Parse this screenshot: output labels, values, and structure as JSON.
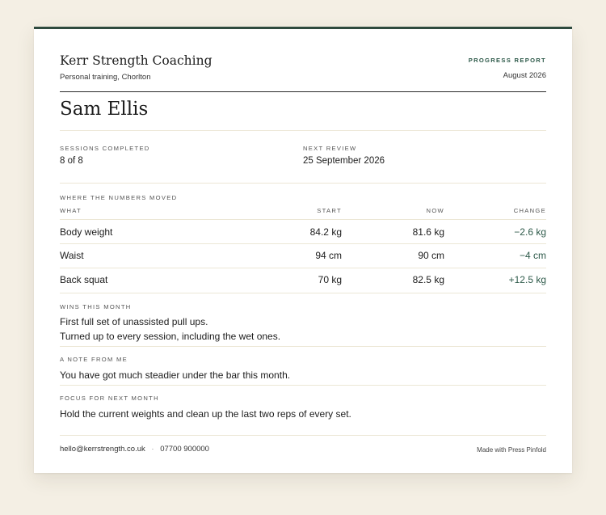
{
  "business": {
    "name": "Kerr Strength Coaching",
    "subtitle": "Personal training, Chorlton"
  },
  "report": {
    "kind": "PROGRESS REPORT",
    "period": "August 2026"
  },
  "client": {
    "name": "Sam Ellis"
  },
  "summary": {
    "sessions_label": "SESSIONS COMPLETED",
    "sessions_value": "8 of 8",
    "review_label": "NEXT REVIEW",
    "review_value": "25 September 2026"
  },
  "numbers": {
    "section_label": "WHERE THE NUMBERS MOVED",
    "headers": {
      "what": "WHAT",
      "start": "START",
      "now": "NOW",
      "change": "CHANGE"
    },
    "rows": [
      {
        "what": "Body weight",
        "start": "84.2 kg",
        "now": "81.6 kg",
        "change": "−2.6 kg"
      },
      {
        "what": "Waist",
        "start": "94 cm",
        "now": "90 cm",
        "change": "−4 cm"
      },
      {
        "what": "Back squat",
        "start": "70 kg",
        "now": "82.5 kg",
        "change": "+12.5 kg"
      }
    ]
  },
  "wins": {
    "label": "WINS THIS MONTH",
    "lines": [
      "First full set of unassisted pull ups.",
      "Turned up to every session, including the wet ones."
    ]
  },
  "note": {
    "label": "A NOTE FROM ME",
    "text": "You have got much steadier under the bar this month."
  },
  "focus": {
    "label": "FOCUS FOR NEXT MONTH",
    "text": "Hold the current weights and clean up the last two reps of every set."
  },
  "footer": {
    "email": "hello@kerrstrength.co.uk",
    "separator": "·",
    "phone": "07700 900000",
    "credit": "Made with Press Pinfold"
  },
  "colors": {
    "accent": "#2e4a3e",
    "positive_change": "#2e5a4a",
    "page_background": "#f4efe4"
  }
}
